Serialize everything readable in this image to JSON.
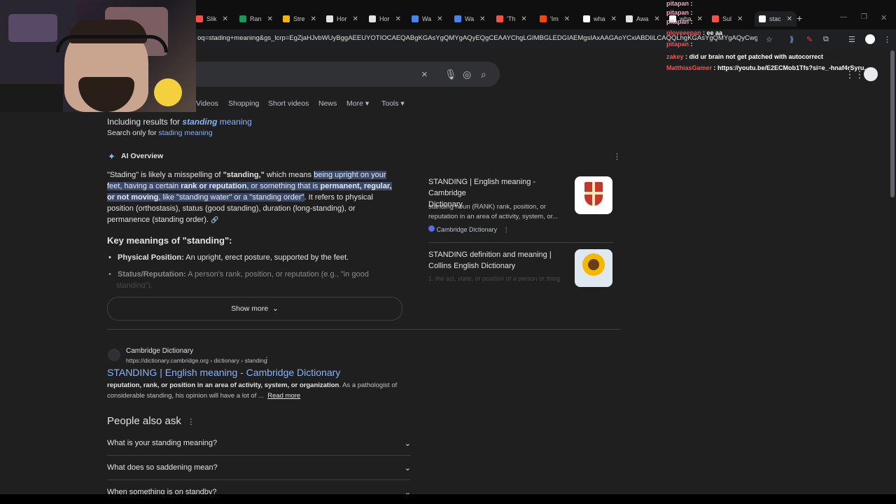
{
  "tabs": [
    {
      "label": "Slik",
      "color": "#ff4e45"
    },
    {
      "label": "Ran",
      "color": "#0f9d58"
    },
    {
      "label": "Stre",
      "color": "#f4b400"
    },
    {
      "label": "Hor",
      "color": "#e3e3e3"
    },
    {
      "label": "Hor",
      "color": "#e3e3e3"
    },
    {
      "label": "Wa",
      "color": "#4285f4"
    },
    {
      "label": "Wa",
      "color": "#4285f4"
    },
    {
      "label": "'Th",
      "color": "#ff4e45"
    },
    {
      "label": "'Im",
      "color": "#ff4500"
    },
    {
      "label": "wha",
      "color": "#ffffff"
    },
    {
      "label": "Awa",
      "color": "#e3e3e3"
    },
    {
      "label": "wha",
      "color": "#ffffff"
    },
    {
      "label": "Sul",
      "color": "#ff4e45"
    },
    {
      "label": "stac",
      "color": "#ffffff"
    }
  ],
  "address": {
    "url": "oq=stading+meaning&gs_lcrp=EgZjaHJvbWUyBggAEEUYOTIOCAEQABgKGAsYgQMYgAQyEQgCEAAYChgLGIMBGLEDGIAEMgsIAxAAGAoYCxiABDIiLCAQQLhgKGAsYgQMYgAQyCwgFEAAYChgLGIAEMgsI..."
  },
  "search": {
    "clear": "×"
  },
  "filters": [
    "Videos",
    "Shopping",
    "Short videos",
    "News",
    "More ▾",
    "Tools ▾"
  ],
  "chat": [
    {
      "name": "pitapan",
      "text": ":"
    },
    {
      "name": "pitapan",
      "text": ":"
    },
    {
      "name": "pitapan",
      "text": ":"
    },
    {
      "name": "gloveeepan",
      "text": ": ee aa"
    },
    {
      "name": "pitapan",
      "text": ":"
    },
    {
      "name": "zakey",
      "text": ": did ur brain not get patched with autocorrect"
    },
    {
      "name": "MatthiasGamer",
      "text": ": https://youtu.be/E2ECMob1Tfs?si=e_-hnaf4rSyru..."
    }
  ],
  "results": {
    "including_prefix": "Including results for",
    "including_term": "standing",
    "including_suffix": "meaning",
    "search_only_prefix": "Search only for",
    "search_only_link": "stading meaning",
    "ai_label": "AI Overview",
    "ai_p1": "\"Stading\" is likely a misspelling of ",
    "ai_p1_bold": "\"standing,\"",
    "ai_p1_tail": " which means ",
    "ai_hl1": "being upright on your",
    "ai_hl2a": "feet, having a certain ",
    "ai_hl2b": "rank or reputation",
    "ai_hl2c": ", or something that is ",
    "ai_hl2d": "permanent, regular,",
    "ai_hl3a": "or not moving",
    "ai_hl3b": ", like \"standing water\" or a \"standing order\"",
    "ai_line3_tail": ". It refers to physical",
    "ai_line4": "position (orthostasis), status (good standing), duration (long-standing), or",
    "ai_line5": "permanence (standing order).",
    "key_heading": "Key meanings of \"standing\":",
    "b1_bold": "Physical Position:",
    "b1_text": " An upright, erect posture, supported by the feet.",
    "b2_bold": "Status/Reputation:",
    "b2_text": " A person's rank, position, or reputation (e.g., \"in good",
    "b2_more": "standing\").",
    "show_more": "Show more",
    "card1_title1": "STANDING | English meaning - Cambridge",
    "card1_title2": "Dictionary",
    "card1_snip1": "standing noun (RANK) rank, position, or",
    "card1_snip2": "reputation in an area of activity, system, or...",
    "card1_source": "Cambridge Dictionary",
    "card2_title1": "STANDING definition and meaning |",
    "card2_title2": "Collins English Dictionary",
    "card2_snip": "1. the act, state, or position of a person or thing",
    "r1_site": "Cambridge Dictionary",
    "r1_url": "https://dictionary.cambridge.org › dictionary › standing",
    "r1_title": "STANDING | English meaning - Cambridge Dictionary",
    "r1_snip_bold": "reputation, rank, or position in an area of activity, system, or organization",
    "r1_snip_tail": ". As a pathologist of",
    "r1_snip2": "considerable standing, his opinion will have a lot of ...",
    "r1_read_more": "Read more",
    "paa_heading": "People also ask",
    "paa": [
      "What is your standing meaning?",
      "What does so saddening mean?",
      "When something is on standby?"
    ]
  }
}
